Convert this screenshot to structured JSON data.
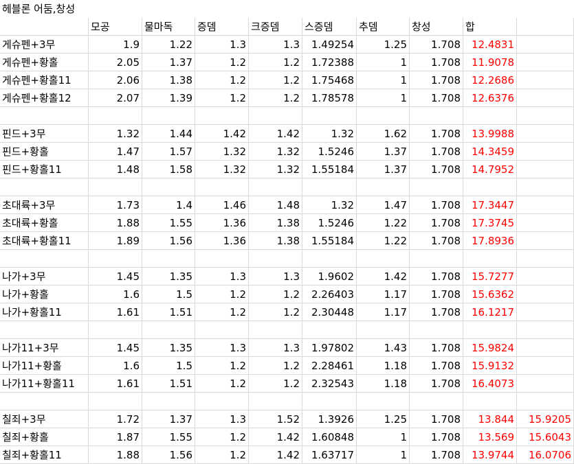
{
  "title": "헤블론 어둠,창성",
  "headers": [
    "",
    "모공",
    "물마독",
    "증뎀",
    "크증뎀",
    "스증뎀",
    "추뎀",
    "창성",
    "합",
    ""
  ],
  "colors": {
    "total": "#ff0000",
    "grid": "#d9d9d9"
  },
  "rows": [
    [
      "게슈펜+3무",
      "1.9",
      "1.22",
      "1.3",
      "1.3",
      "1.49254",
      "1.25",
      "1.708",
      "12.4831",
      ""
    ],
    [
      "게슈펜+황홀",
      "2.05",
      "1.37",
      "1.2",
      "1.2",
      "1.72388",
      "1",
      "1.708",
      "11.9078",
      ""
    ],
    [
      "게슈펜+황홀11",
      "2.06",
      "1.38",
      "1.2",
      "1.2",
      "1.75468",
      "1",
      "1.708",
      "12.2686",
      ""
    ],
    [
      "게슈펜+황홀12",
      "2.07",
      "1.39",
      "1.2",
      "1.2",
      "1.78578",
      "1",
      "1.708",
      "12.6376",
      ""
    ],
    [
      "",
      "",
      "",
      "",
      "",
      "",
      "",
      "",
      "",
      ""
    ],
    [
      "핀드+3무",
      "1.32",
      "1.44",
      "1.42",
      "1.42",
      "1.32",
      "1.62",
      "1.708",
      "13.9988",
      ""
    ],
    [
      "핀드+황홀",
      "1.47",
      "1.57",
      "1.32",
      "1.32",
      "1.5246",
      "1.37",
      "1.708",
      "14.3459",
      ""
    ],
    [
      "핀드+황홀11",
      "1.48",
      "1.58",
      "1.32",
      "1.32",
      "1.55184",
      "1.37",
      "1.708",
      "14.7952",
      ""
    ],
    [
      "",
      "",
      "",
      "",
      "",
      "",
      "",
      "",
      "",
      ""
    ],
    [
      "초대륙+3무",
      "1.73",
      "1.4",
      "1.46",
      "1.48",
      "1.32",
      "1.47",
      "1.708",
      "17.3447",
      ""
    ],
    [
      "초대륙+황홀",
      "1.88",
      "1.55",
      "1.36",
      "1.38",
      "1.5246",
      "1.22",
      "1.708",
      "17.3745",
      ""
    ],
    [
      "초대륙+황홀11",
      "1.89",
      "1.56",
      "1.36",
      "1.38",
      "1.55184",
      "1.22",
      "1.708",
      "17.8936",
      ""
    ],
    [
      "",
      "",
      "",
      "",
      "",
      "",
      "",
      "",
      "",
      ""
    ],
    [
      "나가+3무",
      "1.45",
      "1.35",
      "1.3",
      "1.3",
      "1.9602",
      "1.42",
      "1.708",
      "15.7277",
      ""
    ],
    [
      "나가+황홀",
      "1.6",
      "1.5",
      "1.2",
      "1.2",
      "2.26403",
      "1.17",
      "1.708",
      "15.6362",
      ""
    ],
    [
      "나가+황홀11",
      "1.61",
      "1.51",
      "1.2",
      "1.2",
      "2.30448",
      "1.17",
      "1.708",
      "16.1217",
      ""
    ],
    [
      "",
      "",
      "",
      "",
      "",
      "",
      "",
      "",
      "",
      ""
    ],
    [
      "나가11+3무",
      "1.45",
      "1.35",
      "1.3",
      "1.3",
      "1.97802",
      "1.43",
      "1.708",
      "15.9824",
      ""
    ],
    [
      "나가11+황홀",
      "1.6",
      "1.5",
      "1.2",
      "1.2",
      "2.28461",
      "1.18",
      "1.708",
      "15.9132",
      ""
    ],
    [
      "나가11+황홀11",
      "1.61",
      "1.51",
      "1.2",
      "1.2",
      "2.32543",
      "1.18",
      "1.708",
      "16.4073",
      ""
    ],
    [
      "",
      "",
      "",
      "",
      "",
      "",
      "",
      "",
      "",
      ""
    ],
    [
      "칠죄+3무",
      "1.72",
      "1.37",
      "1.3",
      "1.52",
      "1.3926",
      "1.25",
      "1.708",
      "13.844",
      "15.9205"
    ],
    [
      "칠죄+황홀",
      "1.87",
      "1.55",
      "1.2",
      "1.42",
      "1.60848",
      "1",
      "1.708",
      "13.569",
      "15.6043"
    ],
    [
      "칠죄+황홀11",
      "1.88",
      "1.56",
      "1.2",
      "1.42",
      "1.63717",
      "1",
      "1.708",
      "13.9744",
      "16.0706"
    ]
  ]
}
